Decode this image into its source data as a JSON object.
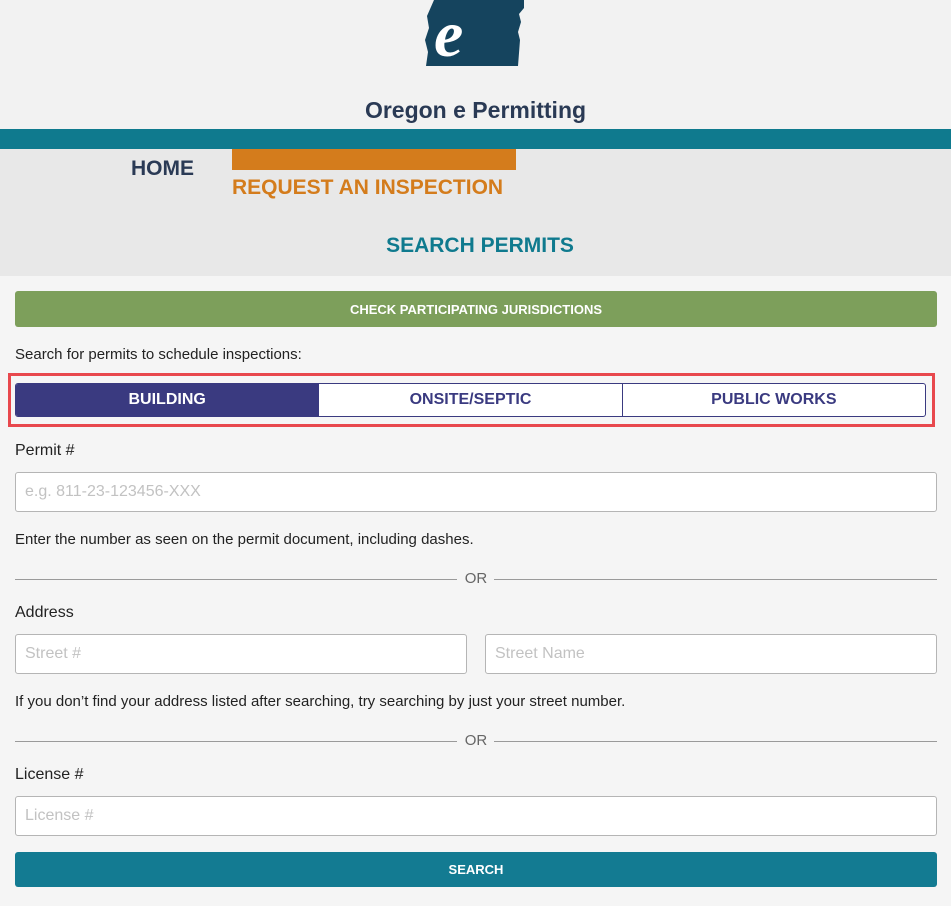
{
  "header": {
    "logo_letter": "e",
    "site_title": "Oregon e Permitting"
  },
  "nav": {
    "home": "HOME",
    "request_inspection": "REQUEST AN INSPECTION",
    "search_permits": "SEARCH PERMITS"
  },
  "check_jurisdictions_label": "CHECK PARTICIPATING JURISDICTIONS",
  "intro_text": "Search for permits to schedule inspections:",
  "tabs": [
    {
      "label": "BUILDING",
      "active": true
    },
    {
      "label": "ONSITE/SEPTIC",
      "active": false
    },
    {
      "label": "PUBLIC WORKS",
      "active": false
    }
  ],
  "permit": {
    "label": "Permit #",
    "placeholder": "e.g. 811-23-123456-XXX",
    "value": "",
    "help": "Enter the number as seen on the permit document, including dashes."
  },
  "divider_text": "OR",
  "address": {
    "label": "Address",
    "street_number_placeholder": "Street #",
    "street_name_placeholder": "Street Name",
    "help": "If you don’t find your address listed after searching, try searching by just your street number."
  },
  "license": {
    "label": "License #",
    "placeholder": "License #"
  },
  "search_label": "SEARCH",
  "colors": {
    "teal": "#0f7a8e",
    "orange": "#d47c1c",
    "navy": "#3a3a80",
    "green": "#7d9f5b",
    "highlight": "#e8484d",
    "logo": "#15445e"
  }
}
